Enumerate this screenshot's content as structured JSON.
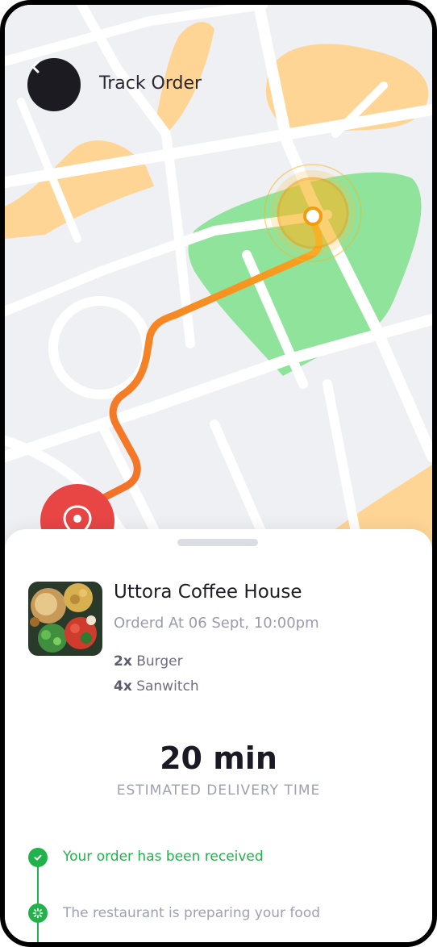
{
  "header": {
    "title": "Track Order",
    "back_icon": "chevron-left-icon"
  },
  "map": {
    "colors": {
      "background": "#eef0f3",
      "road": "#ffffff",
      "water_area": "#ffd596",
      "park_area": "#8fe39a",
      "route_start": "#f26b2a",
      "route_end": "#f8a51d",
      "destination_pin": "#e84545",
      "courier_marker": "#f6b824"
    },
    "courier_icon": "location-target-icon",
    "destination_icon": "map-pin-icon"
  },
  "order": {
    "store_name": "Uttora Coffee House",
    "ordered_at": "Orderd At 06 Sept, 10:00pm",
    "items": [
      {
        "qty": "2x",
        "name": "Burger"
      },
      {
        "qty": "4x",
        "name": "Sanwitch"
      }
    ]
  },
  "eta": {
    "value": "20 min",
    "label": "ESTIMATED DELIVERY TIME"
  },
  "timeline": {
    "steps": [
      {
        "text": "Your order has been received",
        "status": "done",
        "color": "#22b24c"
      },
      {
        "text": "The restaurant is preparing your food",
        "status": "in-progress",
        "color": "#9ea0b3"
      }
    ]
  }
}
